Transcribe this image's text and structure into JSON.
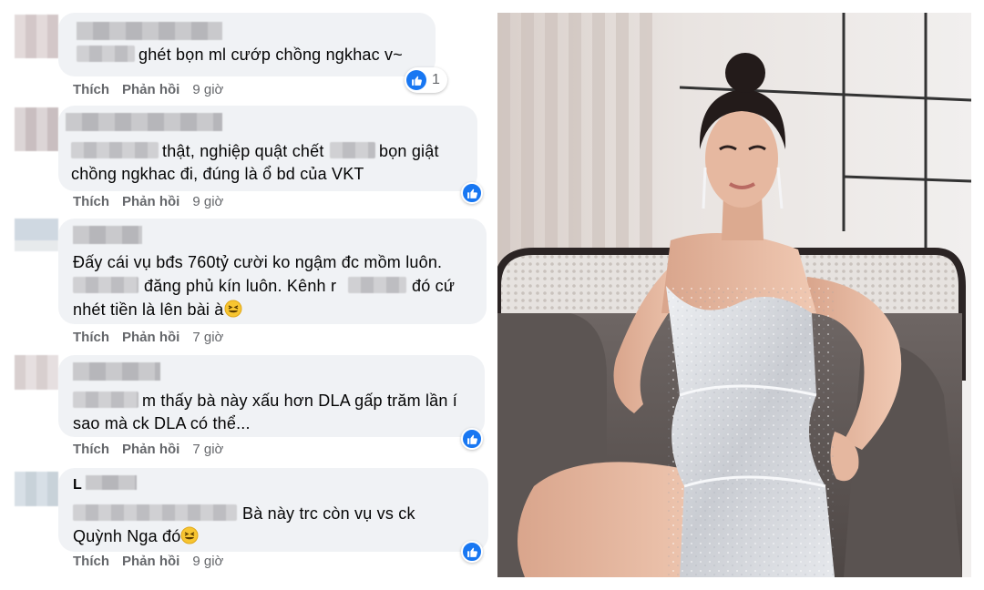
{
  "comments": [
    {
      "lines": [
        "ghét bọn ml cướp chồng ngkhac v~"
      ],
      "actions": {
        "like": "Thích",
        "reply": "Phản hồi",
        "time": "9 giờ"
      },
      "reaction_count": "1"
    },
    {
      "lines": [
        "thật, nghiệp quật chết",
        "bọn giật",
        "chồng ngkhac đi, đúng là ổ bd của VKT"
      ],
      "actions": {
        "like": "Thích",
        "reply": "Phản hồi",
        "time": "9 giờ"
      }
    },
    {
      "lines": [
        "Đấy cái vụ bđs 760tỷ cười ko ngậm đc mồm luôn.",
        "đăng phủ kín luôn. Kênh r",
        "đó cứ",
        "nhét tiền là lên bài à"
      ],
      "actions": {
        "like": "Thích",
        "reply": "Phản hồi",
        "time": "7 giờ"
      }
    },
    {
      "lines": [
        "m thấy bà này xấu hơn DLA gấp trăm lần í",
        "sao mà ck DLA có thể..."
      ],
      "actions": {
        "like": "Thích",
        "reply": "Phản hồi",
        "time": "7 giờ"
      }
    },
    {
      "name_partial": "L",
      "lines": [
        "Bà này trc còn vụ vs ck",
        "Quỳnh Nga đó"
      ],
      "actions": {
        "like": "Thích",
        "reply": "Phản hồi",
        "time": "9 giờ"
      }
    }
  ],
  "icons": {
    "like_badge": "thumbs-up-icon",
    "emoji": "grinning-squinting-face-emoji"
  },
  "colors": {
    "bubble": "#f0f2f5",
    "like_blue": "#1877f2",
    "meta_gray": "#65676b"
  }
}
